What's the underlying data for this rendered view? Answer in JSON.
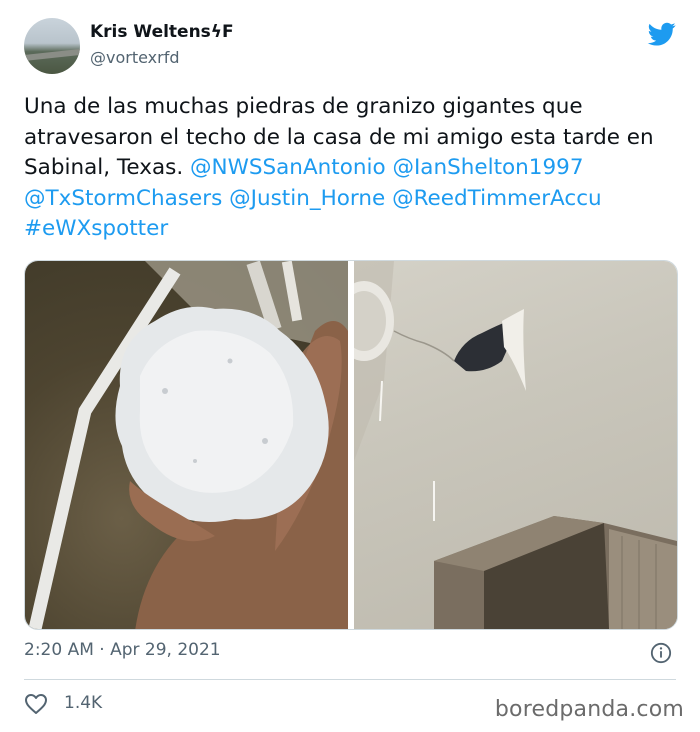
{
  "author": {
    "display_name": "Kris WeltensϟF",
    "handle": "@vortexrfd"
  },
  "tweet": {
    "text_plain": "Una de las muchas piedras de granizo gigantes que atravesaron el techo de la casa de mi amigo esta tarde en Sabinal, Texas.",
    "mentions": [
      "@NWSSanAntonio",
      "@IanShelton1997",
      "@TxStormChasers",
      "@Justin_Horne",
      "@ReedTimmerAccu"
    ],
    "hashtag": "#eWXspotter",
    "timestamp": "2:20 AM · Apr 29, 2021",
    "likes": "1.4K"
  },
  "icons": {
    "brand": "twitter-bird-icon",
    "info": "info-icon",
    "like": "heart-icon"
  },
  "colors": {
    "link": "#1d9bf0",
    "text": "#0f1419",
    "secondary": "#536471",
    "border": "#cfd9de"
  },
  "watermark": "boredpanda.com"
}
